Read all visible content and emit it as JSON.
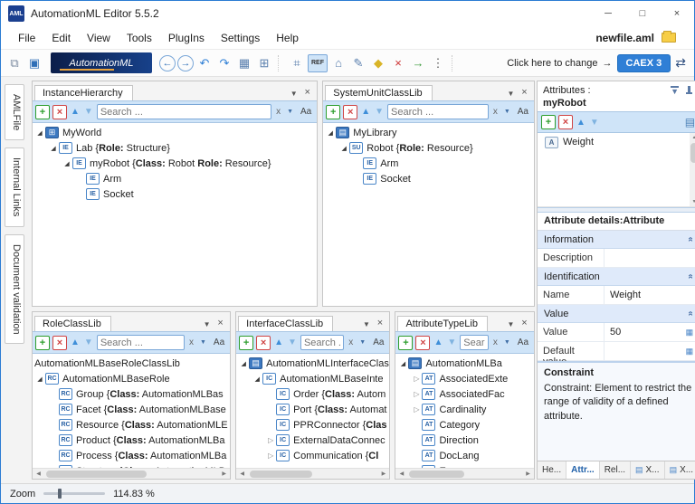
{
  "window": {
    "title": "AutomationML Editor 5.5.2",
    "app_badge": "AML",
    "minimize": "─",
    "maximize": "□",
    "close": "×"
  },
  "menu": {
    "items": [
      "File",
      "Edit",
      "View",
      "Tools",
      "PlugIns",
      "Settings",
      "Help"
    ],
    "file_name": "newfile.aml"
  },
  "toolbar": {
    "logo_text": "AutomationML",
    "left_icons": [
      {
        "name": "new-document-icon",
        "glyph": "⧉",
        "color": "#7a8aa0"
      },
      {
        "name": "save-icon",
        "glyph": "▣",
        "color": "#2f6fb7"
      }
    ],
    "main_icons": [
      {
        "name": "back-icon",
        "glyph": "←",
        "cls": "circ"
      },
      {
        "name": "forward-icon",
        "glyph": "→",
        "cls": "circ"
      },
      {
        "name": "undo-icon",
        "glyph": "↶",
        "color": "#2f7fd6"
      },
      {
        "name": "redo-icon",
        "glyph": "↷",
        "color": "#2f7fd6"
      },
      {
        "name": "grid-icon",
        "glyph": "▦",
        "color": "#5a7fae"
      },
      {
        "name": "grid-zoom-icon",
        "glyph": "⊞",
        "color": "#5a7fae"
      },
      {
        "sep": 1
      },
      {
        "name": "relations-icon",
        "glyph": "⌗",
        "color": "#5a7fae"
      },
      {
        "name": "ref-toggle-button",
        "glyph": "REF",
        "cls": "ref"
      },
      {
        "name": "hierarchy-icon",
        "glyph": "⌂",
        "color": "#5a7fae"
      },
      {
        "name": "edit-icon",
        "glyph": "✎",
        "color": "#5a7fae"
      },
      {
        "name": "key-icon",
        "glyph": "◆",
        "color": "#d9b427"
      },
      {
        "name": "remove-icon",
        "glyph": "×",
        "color": "#cc3333"
      },
      {
        "name": "export-icon",
        "glyph": "→",
        "color": "#3a9a3a"
      },
      {
        "name": "overflow-icon",
        "glyph": "⋮",
        "color": "#555"
      },
      {
        "sep": 1
      }
    ],
    "change_label": "Click here to change",
    "change_arrow": "→",
    "caex_label": "CAEX 3",
    "sync_icon": "⇄"
  },
  "sidebar": {
    "tabs": [
      "AMLFile",
      "Internal Links",
      "Document validation"
    ]
  },
  "search": {
    "placeholder": "Search ...",
    "clear": "x",
    "case_toggle": "Aa"
  },
  "icons": {
    "caret_down": "▼",
    "close": "×",
    "add": "+",
    "remove": "×",
    "up": "▲",
    "down": "▼",
    "chevron_collapse": "»",
    "table": "▦",
    "form": "▤",
    "scroll_left": "◀",
    "scroll_right": "▶",
    "scroll_up": "▲",
    "scroll_down": "▼",
    "attr": "A",
    "expander_open": "◢",
    "expander_closed": "▷",
    "tree": {
      "ie": "IE",
      "rc": "RC",
      "ic": "IC",
      "at": "AT",
      "suc": "SU",
      "lib": "▤",
      "ih": "⊞"
    }
  },
  "panels": {
    "instance_hierarchy": {
      "title": "InstanceHierarchy",
      "tree": [
        {
          "level": 0,
          "exp": "open",
          "icon": "ih",
          "segs": [
            {
              "t": "MyWorld"
            }
          ]
        },
        {
          "level": 1,
          "exp": "open",
          "icon": "ie",
          "segs": [
            {
              "t": "Lab {"
            },
            {
              "t": "Role:",
              "b": 1
            },
            {
              "t": " Structure}"
            }
          ]
        },
        {
          "level": 2,
          "exp": "open",
          "icon": "ie",
          "segs": [
            {
              "t": "myRobot {"
            },
            {
              "t": "Class:",
              "b": 1
            },
            {
              "t": " Robot "
            },
            {
              "t": "Role:",
              "b": 1
            },
            {
              "t": " Resource}"
            }
          ]
        },
        {
          "level": 3,
          "icon": "ie",
          "segs": [
            {
              "t": "Arm"
            }
          ]
        },
        {
          "level": 3,
          "icon": "ie",
          "segs": [
            {
              "t": "Socket"
            }
          ]
        }
      ]
    },
    "system_unit": {
      "title": "SystemUnitClassLib",
      "tree": [
        {
          "level": 0,
          "exp": "open",
          "icon": "lib",
          "segs": [
            {
              "t": "MyLibrary"
            }
          ]
        },
        {
          "level": 1,
          "exp": "open",
          "icon": "suc",
          "segs": [
            {
              "t": "Robot {"
            },
            {
              "t": "Role:",
              "b": 1
            },
            {
              "t": " Resource}"
            }
          ]
        },
        {
          "level": 2,
          "icon": "ie",
          "segs": [
            {
              "t": "Arm"
            }
          ]
        },
        {
          "level": 2,
          "icon": "ie",
          "segs": [
            {
              "t": "Socket"
            }
          ]
        }
      ]
    },
    "role_class": {
      "title": "RoleClassLib",
      "tree": [
        {
          "level": 0,
          "flush": 1,
          "segs": [
            {
              "t": "AutomationMLBaseRoleClassLib"
            }
          ]
        },
        {
          "level": 0,
          "exp": "open",
          "icon": "rc",
          "segs": [
            {
              "t": "AutomationMLBaseRole"
            }
          ]
        },
        {
          "level": 1,
          "icon": "rc",
          "segs": [
            {
              "t": "Group {"
            },
            {
              "t": "Class:",
              "b": 1
            },
            {
              "t": " AutomationMLBas"
            }
          ]
        },
        {
          "level": 1,
          "icon": "rc",
          "segs": [
            {
              "t": "Facet {"
            },
            {
              "t": "Class:",
              "b": 1
            },
            {
              "t": " AutomationMLBase"
            }
          ]
        },
        {
          "level": 1,
          "icon": "rc",
          "segs": [
            {
              "t": "Resource {"
            },
            {
              "t": "Class:",
              "b": 1
            },
            {
              "t": " AutomationMLE"
            }
          ]
        },
        {
          "level": 1,
          "icon": "rc",
          "segs": [
            {
              "t": "Product {"
            },
            {
              "t": "Class:",
              "b": 1
            },
            {
              "t": " AutomationMLBa"
            }
          ]
        },
        {
          "level": 1,
          "icon": "rc",
          "segs": [
            {
              "t": "Process {"
            },
            {
              "t": "Class:",
              "b": 1
            },
            {
              "t": " AutomationMLBa"
            }
          ]
        },
        {
          "level": 1,
          "icon": "rc",
          "segs": [
            {
              "t": "Structure {"
            },
            {
              "t": "Class:",
              "b": 1
            },
            {
              "t": " AutomationMLB"
            }
          ]
        }
      ]
    },
    "interface_class": {
      "title": "InterfaceClassLib",
      "tree": [
        {
          "level": 0,
          "exp": "open",
          "icon": "lib",
          "segs": [
            {
              "t": "AutomationMLInterfaceClas"
            }
          ]
        },
        {
          "level": 1,
          "exp": "open",
          "icon": "ic",
          "segs": [
            {
              "t": "AutomationMLBaseInte"
            }
          ]
        },
        {
          "level": 2,
          "icon": "ic",
          "segs": [
            {
              "t": "Order {"
            },
            {
              "t": "Class:",
              "b": 1
            },
            {
              "t": " Autom"
            }
          ]
        },
        {
          "level": 2,
          "icon": "ic",
          "segs": [
            {
              "t": "Port {"
            },
            {
              "t": "Class:",
              "b": 1
            },
            {
              "t": " Automat"
            }
          ]
        },
        {
          "level": 2,
          "icon": "ic",
          "segs": [
            {
              "t": "PPRConnector {"
            },
            {
              "t": "Clas",
              "b": 1
            }
          ]
        },
        {
          "level": 2,
          "exp": "closed",
          "icon": "ic",
          "segs": [
            {
              "t": "ExternalDataConnec"
            }
          ]
        },
        {
          "level": 2,
          "exp": "closed",
          "icon": "ic",
          "segs": [
            {
              "t": "Communication {"
            },
            {
              "t": "Cl",
              "b": 1
            }
          ]
        }
      ]
    },
    "attribute_type": {
      "title": "AttributeTypeLib",
      "tree": [
        {
          "level": 0,
          "exp": "open",
          "icon": "lib",
          "segs": [
            {
              "t": "AutomationMLBa"
            }
          ]
        },
        {
          "level": 1,
          "exp": "closed",
          "icon": "at",
          "segs": [
            {
              "t": "AssociatedExte"
            }
          ]
        },
        {
          "level": 1,
          "exp": "closed",
          "icon": "at",
          "segs": [
            {
              "t": "AssociatedFac"
            }
          ]
        },
        {
          "level": 1,
          "exp": "closed",
          "icon": "at",
          "segs": [
            {
              "t": "Cardinality"
            }
          ]
        },
        {
          "level": 1,
          "icon": "at",
          "segs": [
            {
              "t": "Category"
            }
          ]
        },
        {
          "level": 1,
          "icon": "at",
          "segs": [
            {
              "t": "Direction"
            }
          ]
        },
        {
          "level": 1,
          "icon": "at",
          "segs": [
            {
              "t": "DocLang"
            }
          ]
        },
        {
          "level": 1,
          "icon": "at",
          "segs": [
            {
              "t": "E"
            }
          ]
        }
      ]
    }
  },
  "attributes_panel": {
    "title": "Attributes :",
    "subject": "myRobot",
    "rows": [
      {
        "label": "Weight"
      }
    ]
  },
  "details": {
    "title": "Attribute details:Attribute",
    "info_header": "Information",
    "description_label": "Description",
    "ident_header": "Identification",
    "name_label": "Name",
    "name_value": "Weight",
    "value_header": "Value",
    "value_label": "Value",
    "value_value": "50",
    "default_label": "Default value",
    "default_value": "",
    "constraint_header": "Constraint",
    "constraint_text": "Constraint: Element to restrict the range of validity of a defined attribute."
  },
  "bottom_tabs": [
    {
      "label": "He..."
    },
    {
      "label": "Attr..."
    },
    {
      "label": "Rel..."
    },
    {
      "label": "X..."
    },
    {
      "label": "X..."
    }
  ],
  "statusbar": {
    "zoom_label": "Zoom",
    "zoom_value": "114.83 %"
  }
}
